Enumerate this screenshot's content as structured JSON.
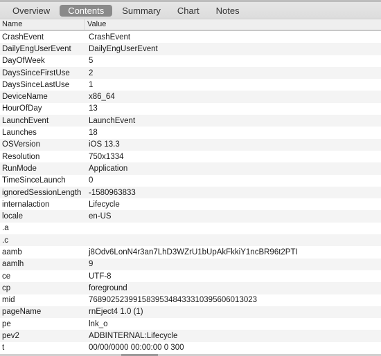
{
  "tabs": [
    {
      "label": "Overview",
      "active": false
    },
    {
      "label": "Contents",
      "active": true
    },
    {
      "label": "Summary",
      "active": false
    },
    {
      "label": "Chart",
      "active": false
    },
    {
      "label": "Notes",
      "active": false
    }
  ],
  "table": {
    "columns": [
      "Name",
      "Value"
    ],
    "rows": [
      {
        "name": "CrashEvent",
        "value": "CrashEvent"
      },
      {
        "name": "DailyEngUserEvent",
        "value": "DailyEngUserEvent"
      },
      {
        "name": "DayOfWeek",
        "value": "5"
      },
      {
        "name": "DaysSinceFirstUse",
        "value": "2"
      },
      {
        "name": "DaysSinceLastUse",
        "value": "1"
      },
      {
        "name": "DeviceName",
        "value": "x86_64"
      },
      {
        "name": "HourOfDay",
        "value": "13"
      },
      {
        "name": "LaunchEvent",
        "value": "LaunchEvent"
      },
      {
        "name": "Launches",
        "value": "18"
      },
      {
        "name": "OSVersion",
        "value": "iOS 13.3"
      },
      {
        "name": "Resolution",
        "value": "750x1334"
      },
      {
        "name": "RunMode",
        "value": "Application"
      },
      {
        "name": "TimeSinceLaunch",
        "value": "0"
      },
      {
        "name": "ignoredSessionLength",
        "value": "-1580963833"
      },
      {
        "name": "internalaction",
        "value": "Lifecycle"
      },
      {
        "name": "locale",
        "value": "en-US"
      },
      {
        "name": ".a",
        "value": ""
      },
      {
        "name": ".c",
        "value": ""
      },
      {
        "name": "aamb",
        "value": "j8Odv6LonN4r3an7LhD3WZrU1bUpAkFkkiY1ncBR96t2PTI"
      },
      {
        "name": "aamlh",
        "value": "9"
      },
      {
        "name": "ce",
        "value": "UTF-8"
      },
      {
        "name": "cp",
        "value": "foreground"
      },
      {
        "name": "mid",
        "value": "76890252399158395348433310395606013023"
      },
      {
        "name": "pageName",
        "value": "rnEject4 1.0 (1)"
      },
      {
        "name": "pe",
        "value": "lnk_o"
      },
      {
        "name": "pev2",
        "value": "ADBINTERNAL:Lifecycle"
      },
      {
        "name": "t",
        "value": "00/00/0000 00:00:00 0 300"
      }
    ]
  }
}
